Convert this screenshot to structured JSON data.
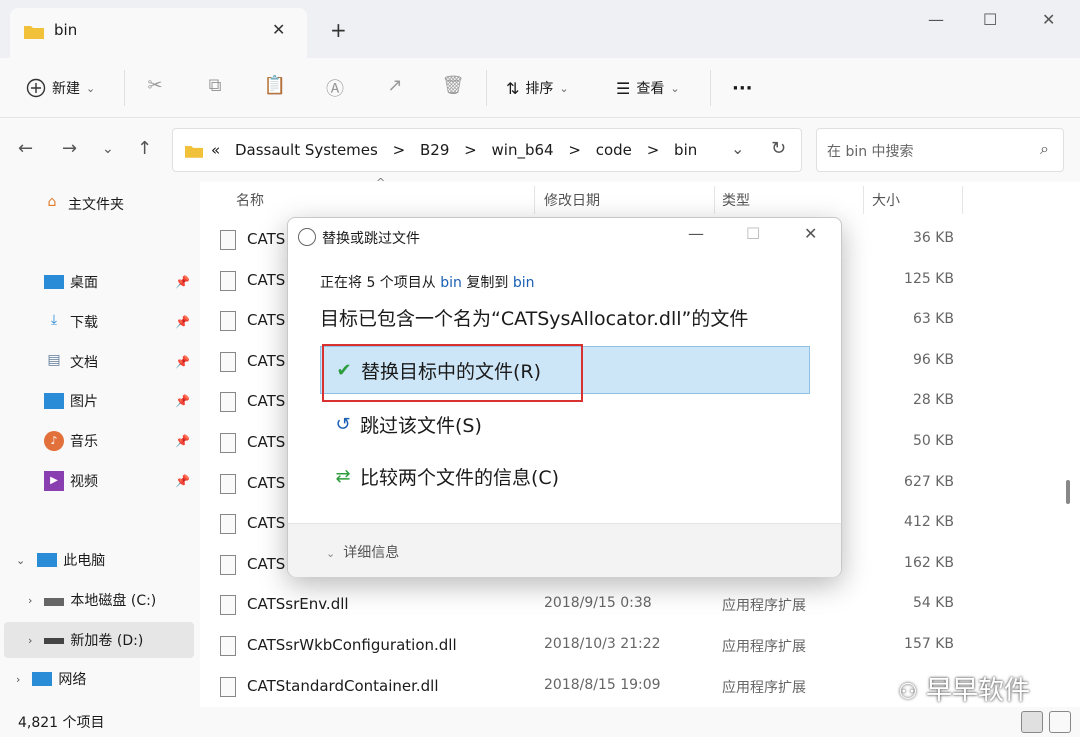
{
  "window": {
    "tab_title": "bin",
    "new_tab": "+",
    "close_tab": "✕",
    "minimize": "—",
    "maximize": "☐",
    "close": "✕"
  },
  "toolbar": {
    "new_label": "新建",
    "sort_label": "排序",
    "view_label": "查看",
    "more_label": "···",
    "dropdown": "⌄"
  },
  "address": {
    "prefix": "«",
    "crumbs": [
      "Dassault Systemes",
      "B29",
      "win_b64",
      "code",
      "bin"
    ],
    "separator": ">"
  },
  "search": {
    "placeholder": "在 bin 中搜索"
  },
  "sidebar": {
    "home": "主文件夹",
    "quick": [
      {
        "label": "桌面",
        "icon": "desktop-icon"
      },
      {
        "label": "下载",
        "icon": "download-icon"
      },
      {
        "label": "文档",
        "icon": "document-icon"
      },
      {
        "label": "图片",
        "icon": "picture-icon"
      },
      {
        "label": "音乐",
        "icon": "music-icon"
      },
      {
        "label": "视频",
        "icon": "video-icon"
      }
    ],
    "this_pc": "此电脑",
    "drives": [
      {
        "label": "本地磁盘 (C:)"
      },
      {
        "label": "新加卷 (D:)"
      }
    ],
    "network": "网络"
  },
  "columns": {
    "name": "名称",
    "date": "修改日期",
    "type": "类型",
    "size": "大小"
  },
  "files": [
    {
      "name": "CATS",
      "date": "",
      "type": "",
      "size": "36 KB"
    },
    {
      "name": "CATS",
      "date": "",
      "type": "",
      "size": "125 KB"
    },
    {
      "name": "CATS",
      "date": "",
      "type": "",
      "size": "63 KB"
    },
    {
      "name": "CATS",
      "date": "",
      "type": "",
      "size": "96 KB"
    },
    {
      "name": "CATS",
      "date": "",
      "type": "",
      "size": "28 KB"
    },
    {
      "name": "CATS",
      "date": "",
      "type": "",
      "size": "50 KB"
    },
    {
      "name": "CATS",
      "date": "",
      "type": "",
      "size": "627 KB"
    },
    {
      "name": "CATS",
      "date": "",
      "type": "",
      "size": "412 KB"
    },
    {
      "name": "CATS",
      "date": "",
      "type": "",
      "size": "162 KB"
    },
    {
      "name": "CATSsrEnv.dll",
      "date": "2018/9/15 0:38",
      "type": "应用程序扩展",
      "size": "54 KB"
    },
    {
      "name": "CATSsrWkbConfiguration.dll",
      "date": "2018/10/3 21:22",
      "type": "应用程序扩展",
      "size": "157 KB"
    },
    {
      "name": "CATStandardContainer.dll",
      "date": "2018/8/15 19:09",
      "type": "应用程序扩展",
      "size": ""
    }
  ],
  "status": {
    "count": "4,821 个项目"
  },
  "dialog": {
    "title": "替换或跳过文件",
    "line1_a": "正在将 5 个项目从 ",
    "line1_src": "bin",
    "line1_b": " 复制到 ",
    "line1_dst": "bin",
    "line2": "目标已包含一个名为“CATSysAllocator.dll”的文件",
    "replace": "替换目标中的文件(R)",
    "skip": "跳过该文件(S)",
    "compare": "比较两个文件的信息(C)",
    "details": "详细信息"
  },
  "watermark": "早早软件",
  "colors": {
    "accent": "#1a5fb4",
    "highlight": "#cde6f7",
    "red_box": "#d93030",
    "check_green": "#2e9d3e"
  }
}
